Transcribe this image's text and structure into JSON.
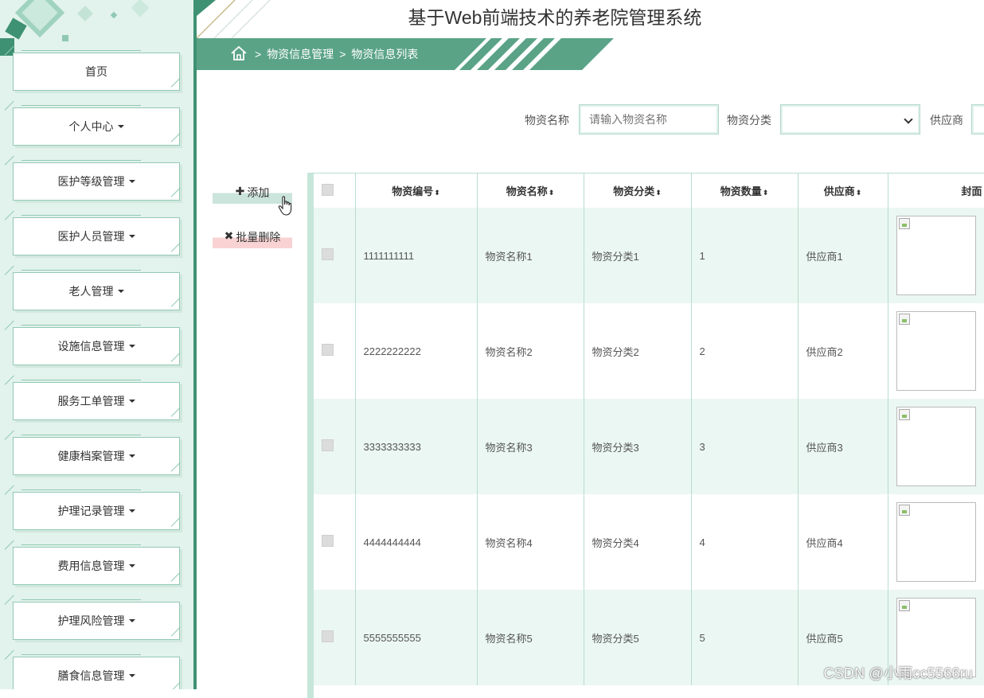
{
  "header": {
    "title": "基于Web前端技术的养老院管理系统"
  },
  "breadcrumb": {
    "separator": ">",
    "items": [
      "物资信息管理",
      "物资信息列表"
    ]
  },
  "sidebar": {
    "items": [
      {
        "label": "首页",
        "has_dropdown": false
      },
      {
        "label": "个人中心",
        "has_dropdown": true
      },
      {
        "label": "医护等级管理",
        "has_dropdown": true
      },
      {
        "label": "医护人员管理",
        "has_dropdown": true
      },
      {
        "label": "老人管理",
        "has_dropdown": true
      },
      {
        "label": "设施信息管理",
        "has_dropdown": true
      },
      {
        "label": "服务工单管理",
        "has_dropdown": true
      },
      {
        "label": "健康档案管理",
        "has_dropdown": true
      },
      {
        "label": "护理记录管理",
        "has_dropdown": true
      },
      {
        "label": "费用信息管理",
        "has_dropdown": true
      },
      {
        "label": "护理风险管理",
        "has_dropdown": true
      },
      {
        "label": "膳食信息管理",
        "has_dropdown": true
      }
    ]
  },
  "search": {
    "name_label": "物资名称",
    "name_placeholder": "请输入物资名称",
    "category_label": "物资分类",
    "category_value": "",
    "supplier_label": "供应商"
  },
  "actions": {
    "add_label": "添加",
    "batch_delete_label": "批量删除"
  },
  "table": {
    "columns": [
      "物资编号",
      "物资名称",
      "物资分类",
      "物资数量",
      "供应商",
      "封面"
    ],
    "sort_icon": "⬍",
    "rows": [
      {
        "code": "1111111111",
        "name": "物资名称1",
        "category": "物资分类1",
        "quantity": "1",
        "supplier": "供应商1"
      },
      {
        "code": "2222222222",
        "name": "物资名称2",
        "category": "物资分类2",
        "quantity": "2",
        "supplier": "供应商2"
      },
      {
        "code": "3333333333",
        "name": "物资名称3",
        "category": "物资分类3",
        "quantity": "3",
        "supplier": "供应商3"
      },
      {
        "code": "4444444444",
        "name": "物资名称4",
        "category": "物资分类4",
        "quantity": "4",
        "supplier": "供应商4"
      },
      {
        "code": "5555555555",
        "name": "物资名称5",
        "category": "物资分类5",
        "quantity": "5",
        "supplier": "供应商5"
      }
    ]
  },
  "watermark": "CSDN @小雨cc5566ru",
  "colors": {
    "primary": "#3f9173",
    "sidebar_bg": "#e2f2ec",
    "row_alt": "#ebf7f2",
    "border": "#b8ddd0"
  }
}
